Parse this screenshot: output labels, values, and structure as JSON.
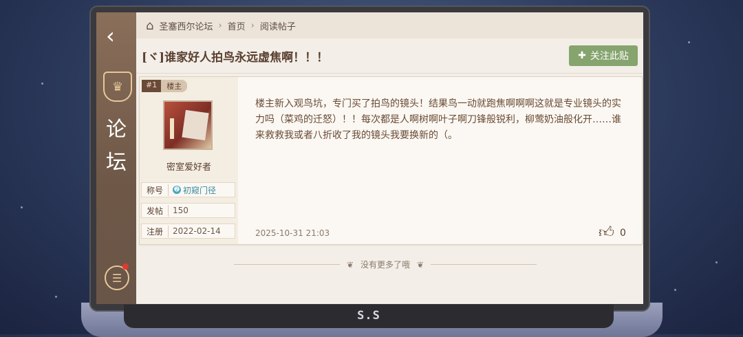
{
  "breadcrumb": {
    "forum": "圣塞西尔论坛",
    "home": "首页",
    "current": "阅读帖子"
  },
  "sidebar": {
    "title_1": "论",
    "title_2": "坛"
  },
  "post": {
    "title": "[ヾ]谁家好人拍鸟永远虚焦啊！！！",
    "follow_label": "关注此贴",
    "floor": "#1",
    "floor_role": "楼主",
    "author": "密室爱好者",
    "stats": {
      "title_label": "称号",
      "title_value": "初窥门径",
      "posts_label": "发帖",
      "posts_value": "150",
      "joined_label": "注册",
      "joined_value": "2022-02-14"
    },
    "body": "楼主新入观鸟坑，专门买了拍鸟的镜头！结果鸟一动就跑焦啊啊啊这就是专业镜头的实力吗（菜鸡的迁怒）！！每次都是人啊树啊叶子啊刀锋般锐利，柳莺奶油般化开……谁来救救我或者八折收了我的镜头我要换新的（。",
    "timestamp": "2025-10-31  21:03",
    "likes": "0"
  },
  "footer": {
    "no_more": "没有更多了哦"
  },
  "laptop": {
    "brand": "S.S"
  },
  "colors": {
    "follow_button": "#86a46e",
    "sidebar": "#7a6252",
    "notification_dot": "#e03a2e"
  }
}
